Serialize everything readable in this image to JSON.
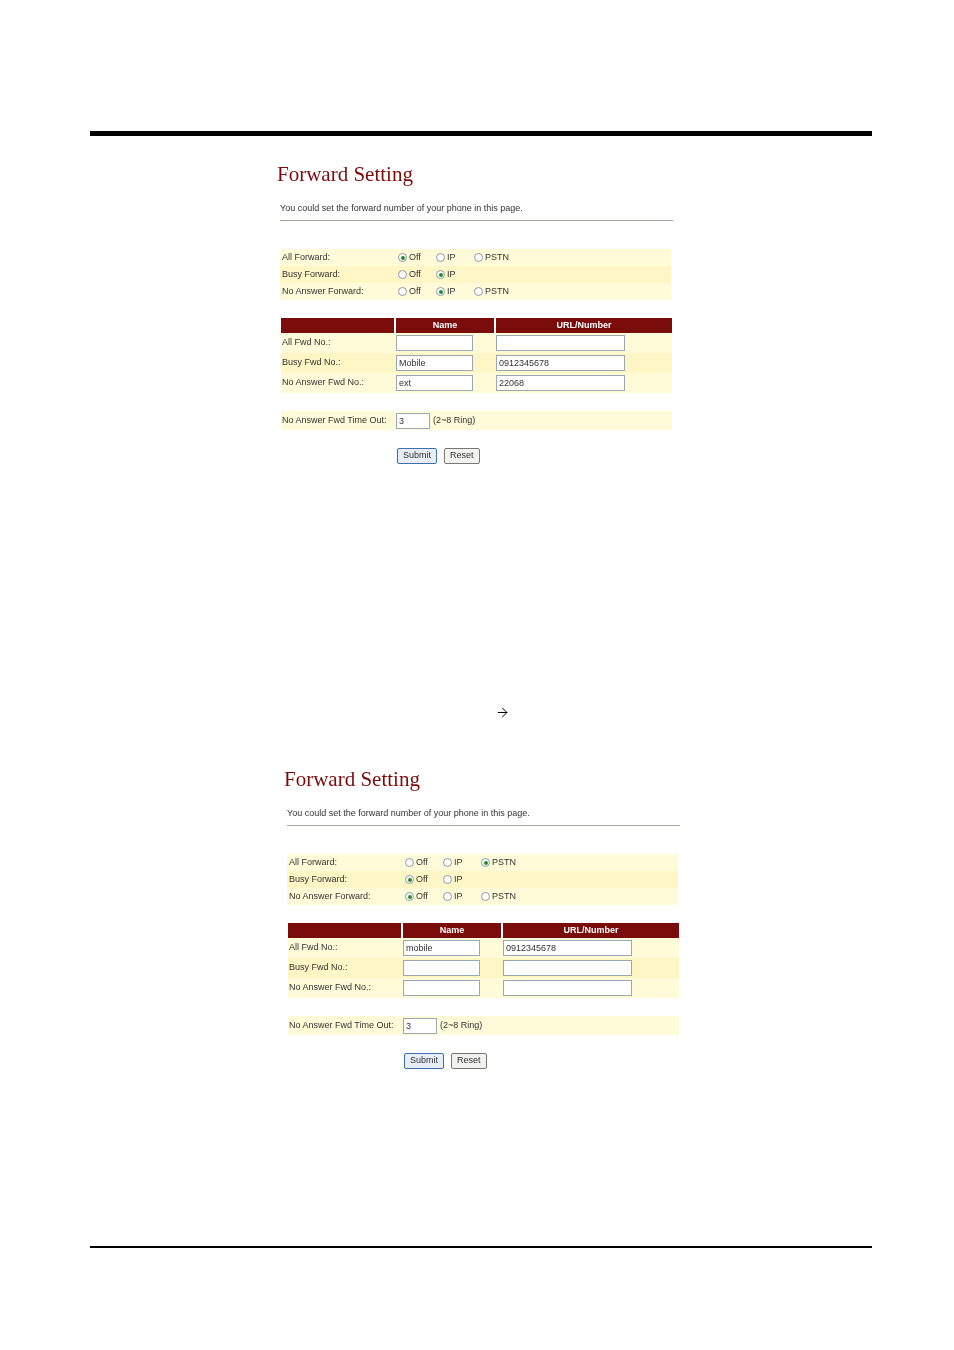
{
  "panels": [
    {
      "title": "Forward Setting",
      "description": "You could set the forward number of your phone in this page.",
      "modes": [
        {
          "label": "All Forward:",
          "options": [
            {
              "label": "Off",
              "selected": true
            },
            {
              "label": "IP",
              "selected": false
            },
            {
              "label": "PSTN",
              "selected": false
            }
          ]
        },
        {
          "label": "Busy Forward:",
          "options": [
            {
              "label": "Off",
              "selected": false
            },
            {
              "label": "IP",
              "selected": true
            }
          ]
        },
        {
          "label": "No Answer Forward:",
          "options": [
            {
              "label": "Off",
              "selected": false
            },
            {
              "label": "IP",
              "selected": true
            },
            {
              "label": "PSTN",
              "selected": false
            }
          ]
        }
      ],
      "columns": [
        "Name",
        "URL/Number"
      ],
      "rows": [
        {
          "label": "All Fwd No.:",
          "name": "",
          "number": ""
        },
        {
          "label": "Busy Fwd No.:",
          "name": "Mobile",
          "number": "0912345678"
        },
        {
          "label": "No Answer Fwd No.:",
          "name": "ext",
          "number": "22068"
        }
      ],
      "timeout": {
        "label": "No Answer Fwd Time Out:",
        "value": "3",
        "hint": "(2~8 Ring)"
      },
      "buttons": [
        "Submit",
        "Reset"
      ]
    },
    {
      "title": "Forward Setting",
      "description": "You could set the forward number of your phone in this page.",
      "modes": [
        {
          "label": "All Forward:",
          "options": [
            {
              "label": "Off",
              "selected": false
            },
            {
              "label": "IP",
              "selected": false
            },
            {
              "label": "PSTN",
              "selected": true
            }
          ]
        },
        {
          "label": "Busy Forward:",
          "options": [
            {
              "label": "Off",
              "selected": true
            },
            {
              "label": "IP",
              "selected": false
            }
          ]
        },
        {
          "label": "No Answer Forward:",
          "options": [
            {
              "label": "Off",
              "selected": true
            },
            {
              "label": "IP",
              "selected": false
            },
            {
              "label": "PSTN",
              "selected": false
            }
          ]
        }
      ],
      "columns": [
        "Name",
        "URL/Number"
      ],
      "rows": [
        {
          "label": "All Fwd No.:",
          "name": "mobile",
          "number": "0912345678"
        },
        {
          "label": "Busy Fwd No.:",
          "name": "",
          "number": ""
        },
        {
          "label": "No Answer Fwd No.:",
          "name": "",
          "number": ""
        }
      ],
      "timeout": {
        "label": "No Answer Fwd Time Out:",
        "value": "3",
        "hint": "(2~8 Ring)"
      },
      "buttons": [
        "Submit",
        "Reset"
      ]
    }
  ]
}
